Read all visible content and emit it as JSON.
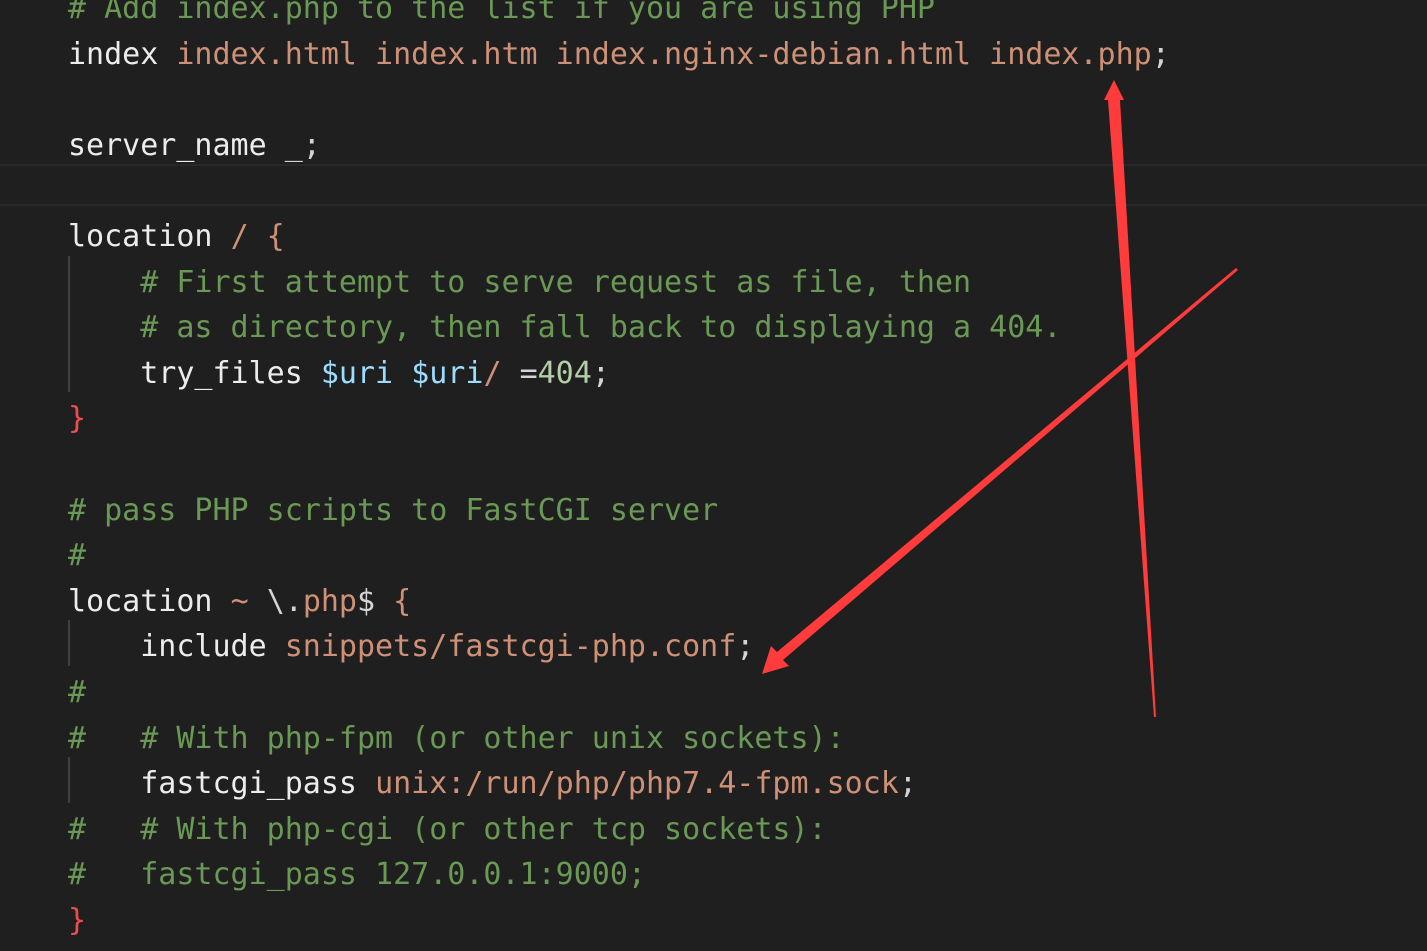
{
  "editor": {
    "language": "nginx",
    "lines": [
      {
        "tokens": [
          {
            "t": "comment",
            "v": "# Add index.php to the list if you are using PHP"
          }
        ]
      },
      {
        "tokens": [
          {
            "t": "directive",
            "v": "index"
          },
          {
            "t": "ws",
            "v": " "
          },
          {
            "t": "string",
            "v": "index.html index.htm index.nginx-debian.html index.php"
          },
          {
            "t": "punct",
            "v": ";"
          }
        ]
      },
      {
        "tokens": []
      },
      {
        "tokens": [
          {
            "t": "directive",
            "v": "server_name"
          },
          {
            "t": "ws",
            "v": " "
          },
          {
            "t": "punct",
            "v": "_;"
          }
        ]
      },
      {
        "tokens": []
      },
      {
        "tokens": [
          {
            "t": "directive",
            "v": "location"
          },
          {
            "t": "ws",
            "v": " "
          },
          {
            "t": "string",
            "v": "/ {"
          }
        ]
      },
      {
        "tokens": [
          {
            "t": "ws",
            "v": "    "
          },
          {
            "t": "comment",
            "v": "# First attempt to serve request as file, then"
          }
        ]
      },
      {
        "tokens": [
          {
            "t": "ws",
            "v": "    "
          },
          {
            "t": "comment",
            "v": "# as directory, then fall back to displaying a 404."
          }
        ]
      },
      {
        "tokens": [
          {
            "t": "ws",
            "v": "    "
          },
          {
            "t": "directive",
            "v": "try_files"
          },
          {
            "t": "ws",
            "v": " "
          },
          {
            "t": "var",
            "v": "$uri"
          },
          {
            "t": "ws",
            "v": " "
          },
          {
            "t": "var",
            "v": "$uri"
          },
          {
            "t": "string",
            "v": "/"
          },
          {
            "t": "ws",
            "v": " "
          },
          {
            "t": "punct",
            "v": "="
          },
          {
            "t": "number",
            "v": "404"
          },
          {
            "t": "punct",
            "v": ";"
          }
        ]
      },
      {
        "tokens": [
          {
            "t": "brace-red",
            "v": "}"
          }
        ]
      },
      {
        "tokens": []
      },
      {
        "tokens": [
          {
            "t": "comment",
            "v": "# pass PHP scripts to FastCGI server"
          }
        ]
      },
      {
        "tokens": [
          {
            "t": "comment",
            "v": "#"
          }
        ]
      },
      {
        "tokens": [
          {
            "t": "directive",
            "v": "location"
          },
          {
            "t": "ws",
            "v": " "
          },
          {
            "t": "string",
            "v": "~ "
          },
          {
            "t": "punct",
            "v": "\\."
          },
          {
            "t": "regex",
            "v": "php"
          },
          {
            "t": "punct",
            "v": "$"
          },
          {
            "t": "ws",
            "v": " "
          },
          {
            "t": "string",
            "v": "{"
          }
        ]
      },
      {
        "tokens": [
          {
            "t": "ws",
            "v": "    "
          },
          {
            "t": "directive",
            "v": "include"
          },
          {
            "t": "ws",
            "v": " "
          },
          {
            "t": "string",
            "v": "snippets/fastcgi-php.conf"
          },
          {
            "t": "punct",
            "v": ";"
          }
        ]
      },
      {
        "tokens": [
          {
            "t": "comment",
            "v": "#"
          }
        ]
      },
      {
        "tokens": [
          {
            "t": "comment",
            "v": "#   # With php-fpm (or other unix sockets):"
          }
        ]
      },
      {
        "tokens": [
          {
            "t": "ws",
            "v": "    "
          },
          {
            "t": "directive",
            "v": "fastcgi_pass"
          },
          {
            "t": "ws",
            "v": " "
          },
          {
            "t": "string",
            "v": "unix:/run/php/php7.4-fpm.sock"
          },
          {
            "t": "punct",
            "v": ";"
          }
        ]
      },
      {
        "tokens": [
          {
            "t": "comment",
            "v": "#   # With php-cgi (or other tcp sockets):"
          }
        ]
      },
      {
        "tokens": [
          {
            "t": "comment",
            "v": "#   fastcgi_pass 127.0.0.1:9000;"
          }
        ]
      },
      {
        "tokens": [
          {
            "t": "brace-red",
            "v": "}"
          }
        ]
      }
    ]
  },
  "annotations": {
    "color": "#ff3b3b",
    "arrows": [
      {
        "name": "arrow-to-index-php",
        "description": "points to index.php"
      },
      {
        "name": "arrow-to-include-line",
        "description": "points to include line"
      }
    ]
  },
  "colors": {
    "background": "#1f1f1f",
    "comment": "#6a9955",
    "string": "#ce9178",
    "directive": "#ececec",
    "variable": "#9cdcfe",
    "number": "#b5cea8",
    "brace": "#f14c4c"
  }
}
